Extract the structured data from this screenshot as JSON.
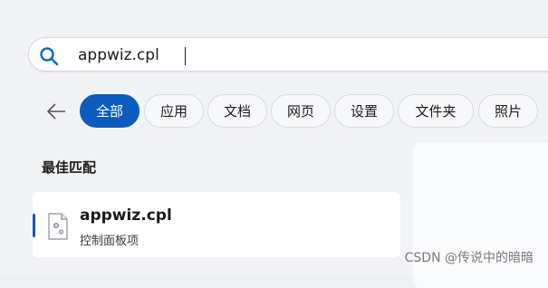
{
  "search": {
    "value": "appwiz.cpl",
    "icon": "search-icon",
    "icon_color": "#0b6cbf"
  },
  "filters": {
    "back_icon": "arrow-left-icon",
    "items": [
      {
        "label": "全部",
        "active": true
      },
      {
        "label": "应用",
        "active": false
      },
      {
        "label": "文档",
        "active": false
      },
      {
        "label": "网页",
        "active": false
      },
      {
        "label": "设置",
        "active": false
      },
      {
        "label": "文件夹",
        "active": false
      },
      {
        "label": "照片",
        "active": false
      }
    ]
  },
  "best_match": {
    "title": "最佳匹配",
    "result": {
      "name": "appwiz.cpl",
      "subtitle": "控制面板项",
      "icon": "settings-file-icon"
    }
  },
  "watermark": "CSDN @传说中的暗暗",
  "colors": {
    "accent": "#0b5cbd",
    "background": "#f2f3f5"
  }
}
